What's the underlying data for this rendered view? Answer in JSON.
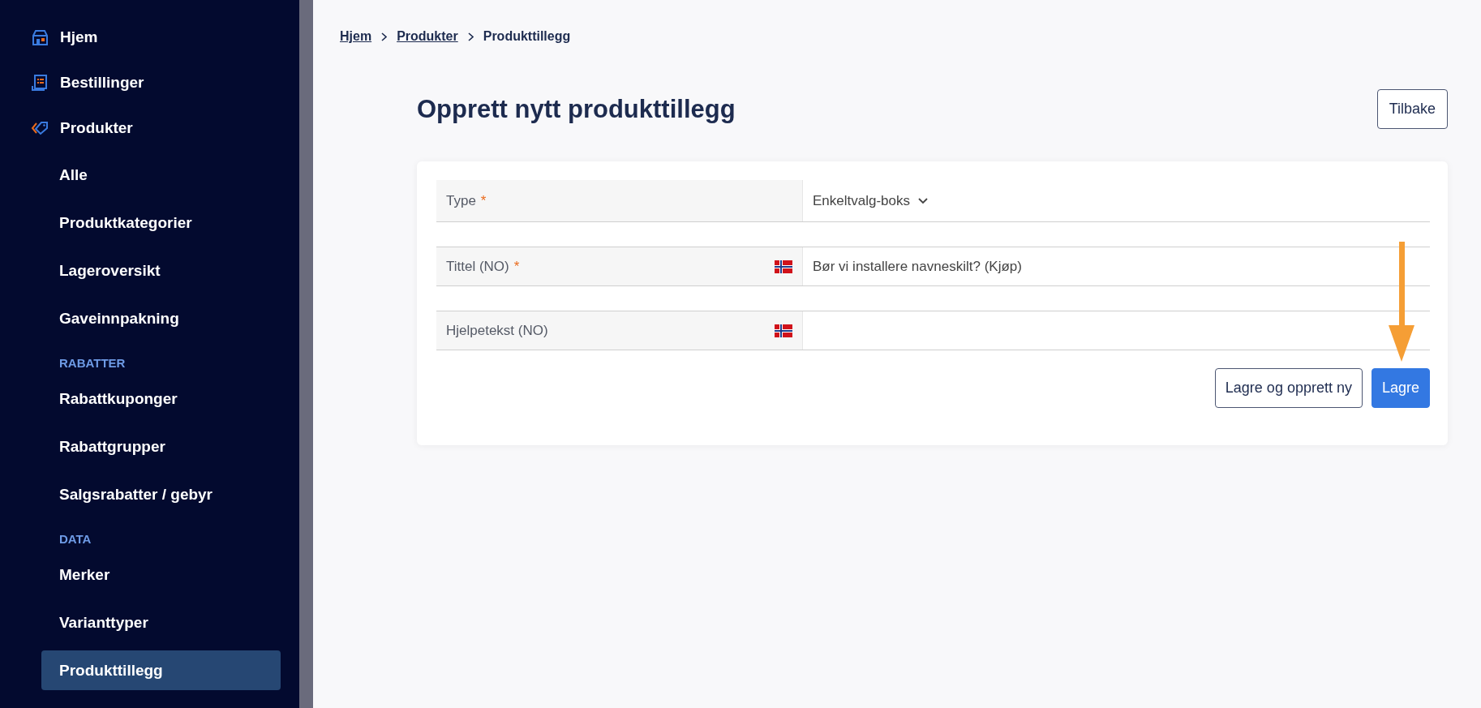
{
  "sidebar": {
    "items": [
      {
        "kind": "main",
        "label": "Hjem",
        "selected": false
      },
      {
        "kind": "main",
        "label": "Bestillinger",
        "selected": false
      },
      {
        "kind": "main",
        "label": "Produkter",
        "selected": false
      },
      {
        "kind": "sub",
        "label": "Alle",
        "selected": false
      },
      {
        "kind": "sub",
        "label": "Produktkategorier",
        "selected": false
      },
      {
        "kind": "sub",
        "label": "Lageroversikt",
        "selected": false
      },
      {
        "kind": "sub",
        "label": "Gaveinnpakning",
        "selected": false
      },
      {
        "kind": "section",
        "label": "RABATTER"
      },
      {
        "kind": "sub",
        "label": "Rabattkuponger",
        "selected": false
      },
      {
        "kind": "sub",
        "label": "Rabattgrupper",
        "selected": false
      },
      {
        "kind": "sub",
        "label": "Salgsrabatter / gebyr",
        "selected": false
      },
      {
        "kind": "section",
        "label": "DATA"
      },
      {
        "kind": "sub",
        "label": "Merker",
        "selected": false
      },
      {
        "kind": "sub",
        "label": "Varianttyper",
        "selected": false
      },
      {
        "kind": "sub",
        "label": "Produkttillegg",
        "selected": true
      }
    ]
  },
  "breadcrumb": [
    {
      "label": "Hjem",
      "link": true
    },
    {
      "label": "Produkter",
      "link": true
    },
    {
      "label": "Produkttillegg",
      "link": false
    }
  ],
  "page": {
    "title": "Opprett nytt produkttillegg",
    "back_button": "Tilbake"
  },
  "form": {
    "fields": [
      {
        "kind": "select",
        "label": "Type",
        "required_mark": "*",
        "translatable": false,
        "value": "Enkeltvalg-boks"
      },
      {
        "kind": "text",
        "label": "Tittel (NO)",
        "required_mark": "*",
        "translatable": true,
        "value": "Bør vi installere navneskilt? (Kjøp)"
      },
      {
        "kind": "text",
        "label": "Hjelpetekst (NO)",
        "translatable": true
      }
    ],
    "buttons": [
      {
        "label": "Lagre og opprett ny",
        "primary": false
      },
      {
        "label": "Lagre",
        "primary": true
      }
    ]
  },
  "annotation": {
    "arrow": true
  }
}
